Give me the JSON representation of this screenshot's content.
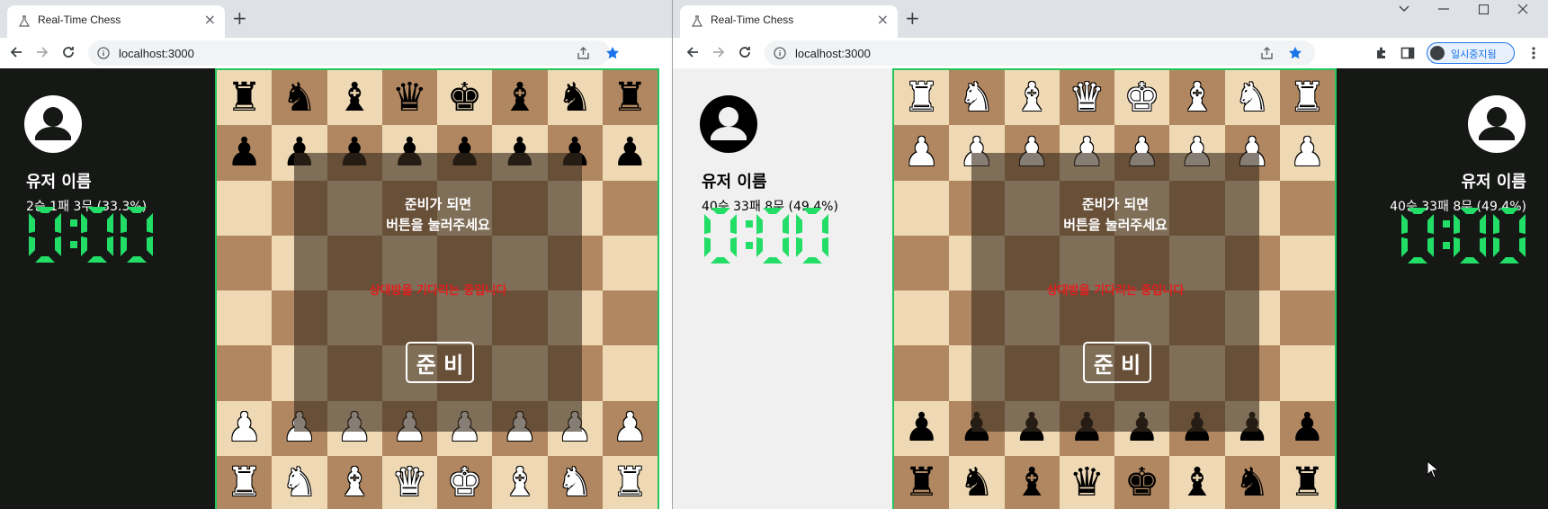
{
  "left_window": {
    "tab": {
      "title": "Real-Time Chess",
      "close": "×"
    },
    "new_tab": "+",
    "url": "localhost:3000",
    "left_player": {
      "name": "유저 이름",
      "record": "2승 1패 3무 (33.3%)",
      "timer": "0:00"
    },
    "overlay": {
      "message": "준비가 되면\n버튼을 눌러주세요",
      "waiting": "상대방을 기다리는 중입니다",
      "ready_button": "준 비"
    },
    "board_orientation": "white-bottom"
  },
  "right_window": {
    "tab": {
      "title": "Real-Time Chess",
      "close": "×"
    },
    "new_tab": "+",
    "url": "localhost:3000",
    "profile_label": "일시중지됨",
    "left_player": {
      "name": "유저 이름",
      "record": "40승 33패 8무 (49.4%)",
      "timer": "0:00"
    },
    "right_player": {
      "name": "유저 이름",
      "record": "40승 33패 8무 (49.4%)",
      "timer": "0:00"
    },
    "overlay": {
      "message": "준비가 되면\n버튼을 눌러주세요",
      "waiting": "상대방을 기다리는 중입니다",
      "ready_button": "준 비"
    },
    "board_orientation": "black-bottom"
  },
  "colors": {
    "timer_green": "#22dd66",
    "board_light": "#efd9b5",
    "board_dark": "#b18761",
    "board_border": "#22c55e",
    "waiting_red": "#e02020"
  },
  "icons": [
    "back-arrow-icon",
    "forward-arrow-icon",
    "reload-icon",
    "info-icon",
    "share-icon",
    "star-icon",
    "extensions-icon",
    "sidepanel-icon",
    "menu-icon",
    "user-avatar-icon",
    "flask-icon"
  ]
}
